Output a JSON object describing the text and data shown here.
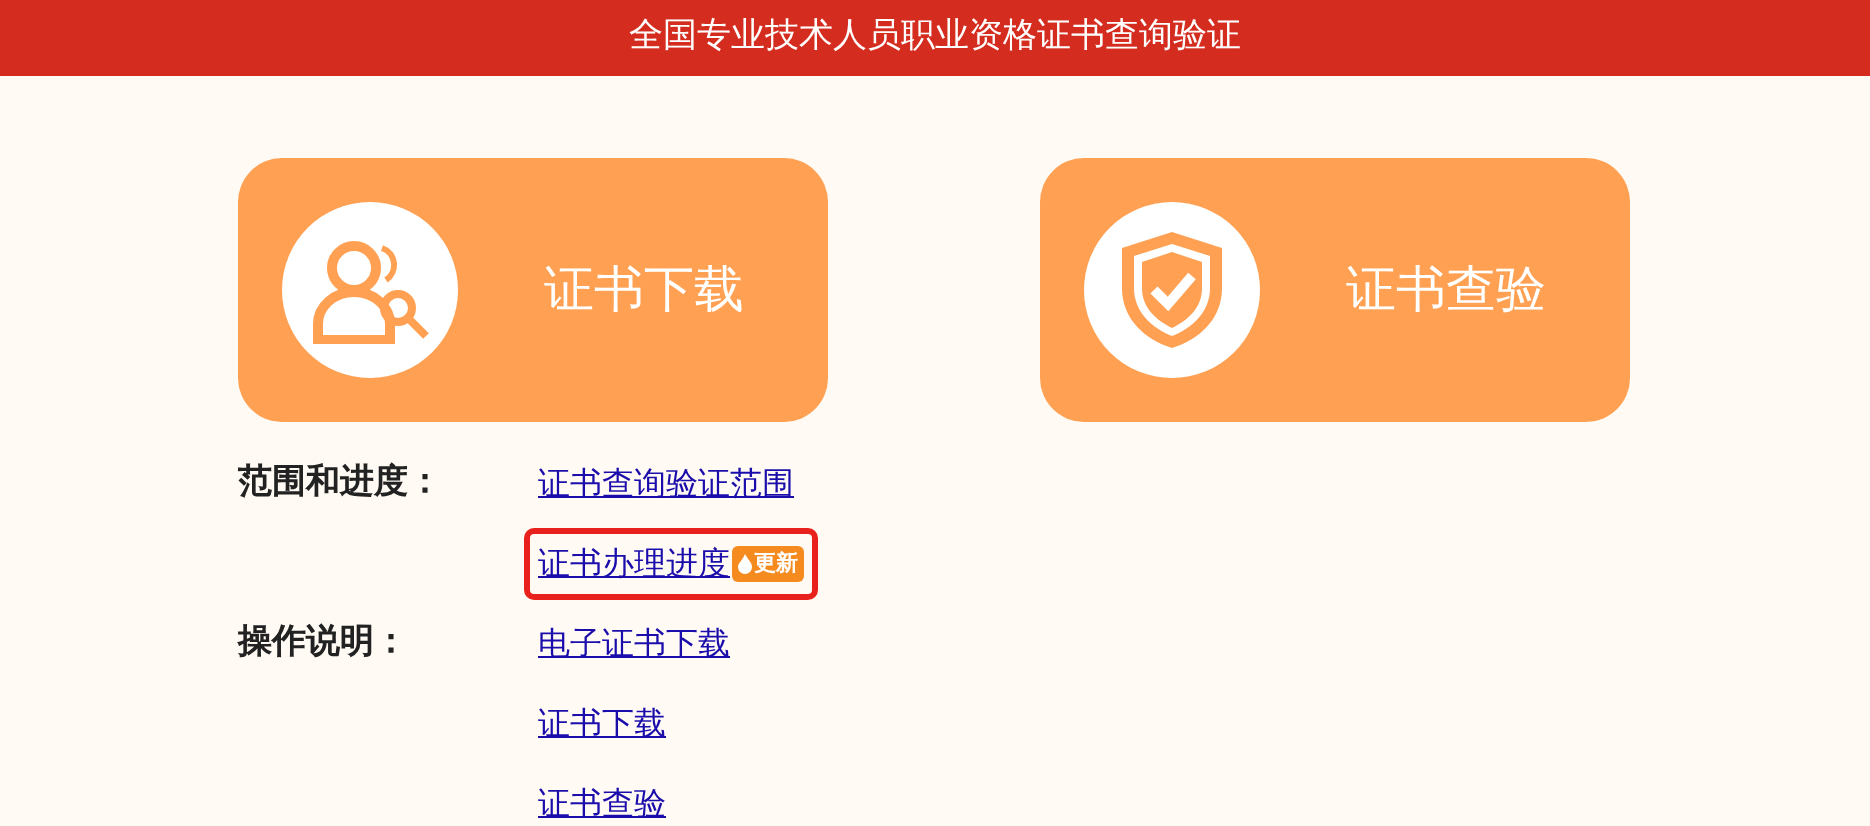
{
  "header": {
    "title": "全国专业技术人员职业资格证书查询验证"
  },
  "cards": [
    {
      "label": "证书下载",
      "kind": "user-search"
    },
    {
      "label": "证书查验",
      "kind": "shield"
    }
  ],
  "sections": [
    {
      "label": "范围和进度：",
      "links": [
        {
          "text": "证书查询验证范围",
          "highlighted": false
        },
        {
          "text": "证书办理进度",
          "highlighted": true,
          "badge": "更新"
        }
      ]
    },
    {
      "label": "操作说明：",
      "links": [
        {
          "text": "电子证书下载",
          "highlighted": false
        },
        {
          "text": "证书下载",
          "highlighted": false
        },
        {
          "text": "证书查验",
          "highlighted": false
        }
      ]
    }
  ]
}
